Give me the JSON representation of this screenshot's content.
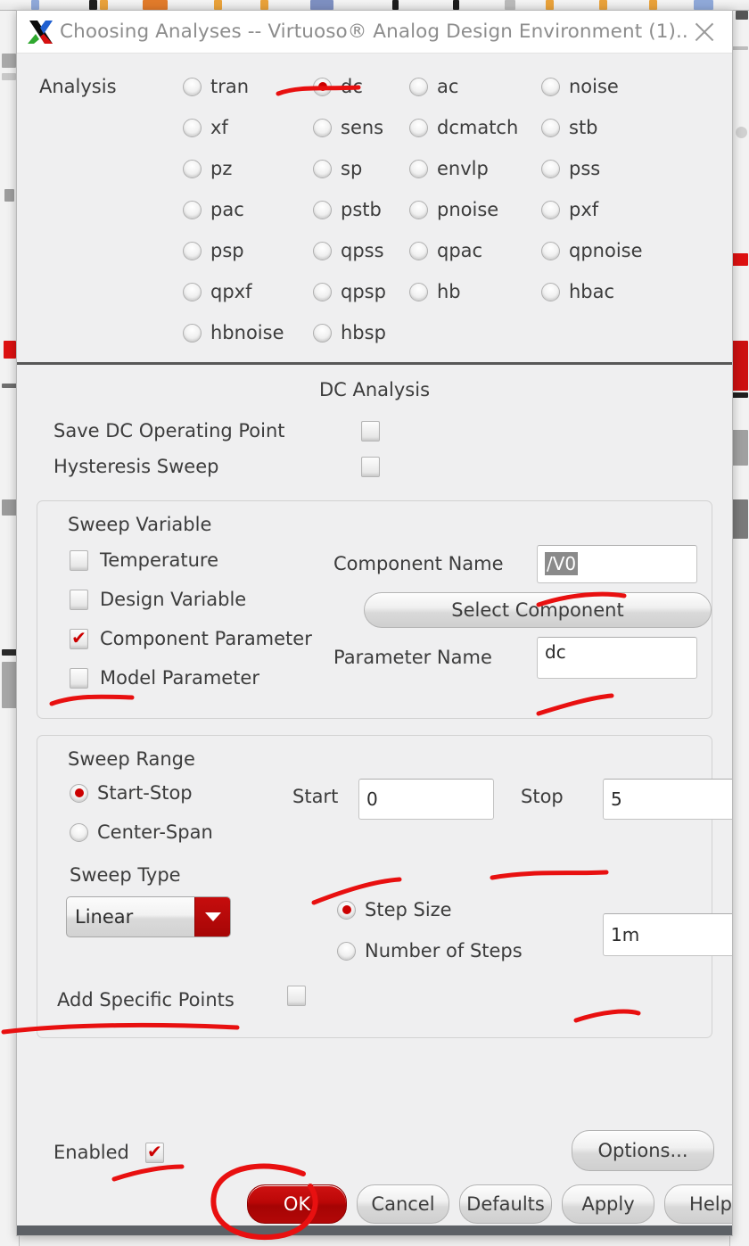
{
  "window": {
    "title": "Choosing Analyses -- Virtuoso® Analog Design Environment (1)...",
    "app_icon": "virtuoso-x-icon",
    "close_icon": "close-icon"
  },
  "analysis": {
    "label": "Analysis",
    "selected": "dc",
    "rows": [
      [
        "tran",
        "dc",
        "ac",
        "noise"
      ],
      [
        "xf",
        "sens",
        "dcmatch",
        "stb"
      ],
      [
        "pz",
        "sp",
        "envlp",
        "pss"
      ],
      [
        "pac",
        "pstb",
        "pnoise",
        "pxf"
      ],
      [
        "psp",
        "qpss",
        "qpac",
        "qpnoise"
      ],
      [
        "qpxf",
        "qpsp",
        "hb",
        "hbac"
      ],
      [
        "hbnoise",
        "hbsp"
      ]
    ]
  },
  "dc_analysis": {
    "heading": "DC Analysis",
    "save_operating_point": {
      "label": "Save DC Operating Point",
      "checked": false
    },
    "hysteresis_sweep": {
      "label": "Hysteresis Sweep",
      "checked": false
    }
  },
  "sweep_variable": {
    "title": "Sweep Variable",
    "options": [
      {
        "label": "Temperature",
        "checked": false
      },
      {
        "label": "Design Variable",
        "checked": false
      },
      {
        "label": "Component Parameter",
        "checked": true
      },
      {
        "label": "Model Parameter",
        "checked": false
      }
    ],
    "component_name_label": "Component Name",
    "component_name_value": "/V0",
    "select_component_button": "Select Component",
    "parameter_name_label": "Parameter Name",
    "parameter_name_value": "dc"
  },
  "sweep_range": {
    "title": "Sweep Range",
    "mode_options": [
      {
        "label": "Start-Stop",
        "selected": true
      },
      {
        "label": "Center-Span",
        "selected": false
      }
    ],
    "start_label": "Start",
    "start_value": "0",
    "stop_label": "Stop",
    "stop_value": "5",
    "sweep_type_label": "Sweep Type",
    "sweep_type_value": "Linear",
    "step_options": [
      {
        "label": "Step Size",
        "selected": true
      },
      {
        "label": "Number of Steps",
        "selected": false
      }
    ],
    "step_value": "1m",
    "add_specific_points_label": "Add Specific Points",
    "add_specific_points_checked": false
  },
  "footer": {
    "enabled_label": "Enabled",
    "enabled_checked": true,
    "options_button": "Options...",
    "buttons": [
      "OK",
      "Cancel",
      "Defaults",
      "Apply",
      "Help"
    ]
  },
  "colors": {
    "accent_red": "#cc0000",
    "primary_button": "#b30808",
    "dialog_bg": "#efeff0",
    "text": "#3c3c3c",
    "annotation_red": "#e81010"
  }
}
